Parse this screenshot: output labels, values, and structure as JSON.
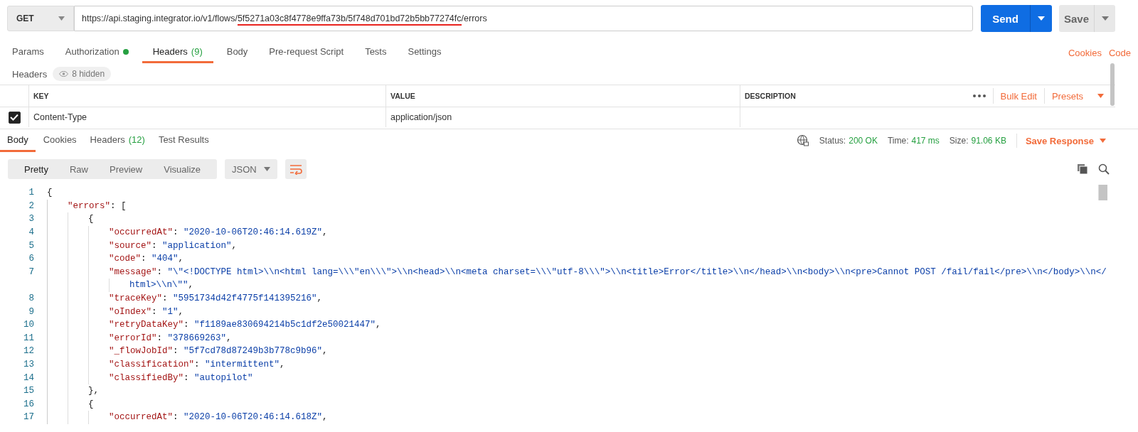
{
  "request": {
    "method": "GET",
    "url": {
      "prefix": "https://api.staging.integrator.io/v1/flows/",
      "underlined": "5f5271a03c8f4778e9ffa73b/5f748d701bd72b5bb77274fc",
      "suffix": "/errors"
    },
    "send_label": "Send",
    "save_label": "Save"
  },
  "request_tabs": [
    {
      "label": "Params",
      "selected": false,
      "dot": false
    },
    {
      "label": "Authorization",
      "selected": false,
      "dot": true
    },
    {
      "label": "Headers",
      "count": "(9)",
      "selected": true,
      "dot": false
    },
    {
      "label": "Body",
      "selected": false,
      "dot": false
    },
    {
      "label": "Pre-request Script",
      "selected": false,
      "dot": false
    },
    {
      "label": "Tests",
      "selected": false,
      "dot": false
    },
    {
      "label": "Settings",
      "selected": false,
      "dot": false
    }
  ],
  "request_links": [
    "Cookies",
    "Code"
  ],
  "headers_bar": {
    "title": "Headers",
    "hidden_label": "8 hidden"
  },
  "headers_table": {
    "columns": [
      "KEY",
      "VALUE",
      "DESCRIPTION"
    ],
    "actions": [
      "Bulk Edit",
      "Presets"
    ],
    "rows": [
      {
        "checked": true,
        "key": "Content-Type",
        "value": "application/json"
      }
    ]
  },
  "response_tabs": [
    {
      "label": "Body",
      "selected": true
    },
    {
      "label": "Cookies",
      "selected": false
    },
    {
      "label": "Headers",
      "count": "(12)",
      "selected": false
    },
    {
      "label": "Test Results",
      "selected": false
    }
  ],
  "response_status": [
    {
      "label": "Status:",
      "value": "200 OK"
    },
    {
      "label": "Time:",
      "value": "417 ms"
    },
    {
      "label": "Size:",
      "value": "91.06 KB"
    }
  ],
  "save_response": "Save Response",
  "view_modes": [
    {
      "label": "Pretty",
      "selected": true
    },
    {
      "label": "Raw",
      "selected": false
    },
    {
      "label": "Preview",
      "selected": false
    },
    {
      "label": "Visualize",
      "selected": false
    }
  ],
  "format": "JSON",
  "code_lines": [
    {
      "number": "1",
      "tokens": [
        {
          "kind": "open",
          "text": "{"
        }
      ]
    },
    {
      "number": "2",
      "tokens": [
        {
          "kind": "key",
          "text": "\"errors\""
        },
        {
          "kind": "punct",
          "text": ": "
        },
        {
          "kind": "open",
          "text": "["
        }
      ]
    },
    {
      "number": "3",
      "tokens": [
        {
          "kind": "open",
          "text": "{"
        }
      ]
    },
    {
      "number": "4",
      "tokens": [
        {
          "kind": "key",
          "text": "\"occurredAt\""
        },
        {
          "kind": "punct",
          "text": ": "
        },
        {
          "kind": "string",
          "text": "\"2020-10-06T20:46:14.619Z\""
        },
        {
          "kind": "punct",
          "text": ","
        }
      ]
    },
    {
      "number": "5",
      "tokens": [
        {
          "kind": "key",
          "text": "\"source\""
        },
        {
          "kind": "punct",
          "text": ": "
        },
        {
          "kind": "string",
          "text": "\"application\""
        },
        {
          "kind": "punct",
          "text": ","
        }
      ]
    },
    {
      "number": "6",
      "tokens": [
        {
          "kind": "key",
          "text": "\"code\""
        },
        {
          "kind": "punct",
          "text": ": "
        },
        {
          "kind": "string",
          "text": "\"404\""
        },
        {
          "kind": "punct",
          "text": ","
        }
      ]
    },
    {
      "number": "7",
      "tokens": [
        {
          "kind": "key",
          "text": "\"message\""
        },
        {
          "kind": "punct",
          "text": ": "
        },
        {
          "kind": "string",
          "text": "\"\\\"<!DOCTYPE html>\\\\n<html lang=\\\\\\\"en\\\\\\\">\\\\n<head>\\\\n<meta charset=\\\\\\\"utf-8\\\\\\\">\\\\n<title>Error</title>\\\\n</head>\\\\n<body>\\\\n<pre>Cannot POST /fail/fail</pre>\\\\n</body>\\\\n</"
        }
      ]
    },
    {
      "tokens": [
        {
          "kind": "string",
          "text": "html>\\\\n\\\"\""
        },
        {
          "kind": "punct",
          "text": ","
        }
      ]
    },
    {
      "number": "8",
      "tokens": [
        {
          "kind": "key",
          "text": "\"traceKey\""
        },
        {
          "kind": "punct",
          "text": ": "
        },
        {
          "kind": "string",
          "text": "\"5951734d42f4775f141395216\""
        },
        {
          "kind": "punct",
          "text": ","
        }
      ]
    },
    {
      "number": "9",
      "tokens": [
        {
          "kind": "key",
          "text": "\"oIndex\""
        },
        {
          "kind": "punct",
          "text": ": "
        },
        {
          "kind": "string",
          "text": "\"1\""
        },
        {
          "kind": "punct",
          "text": ","
        }
      ]
    },
    {
      "number": "10",
      "tokens": [
        {
          "kind": "key",
          "text": "\"retryDataKey\""
        },
        {
          "kind": "punct",
          "text": ": "
        },
        {
          "kind": "string",
          "text": "\"f1189ae830694214b5c1df2e50021447\""
        },
        {
          "kind": "punct",
          "text": ","
        }
      ]
    },
    {
      "number": "11",
      "tokens": [
        {
          "kind": "key",
          "text": "\"errorId\""
        },
        {
          "kind": "punct",
          "text": ": "
        },
        {
          "kind": "string",
          "text": "\"378669263\""
        },
        {
          "kind": "punct",
          "text": ","
        }
      ]
    },
    {
      "number": "12",
      "tokens": [
        {
          "kind": "key",
          "text": "\"_flowJobId\""
        },
        {
          "kind": "punct",
          "text": ": "
        },
        {
          "kind": "string",
          "text": "\"5f7cd78d87249b3b778c9b96\""
        },
        {
          "kind": "punct",
          "text": ","
        }
      ]
    },
    {
      "number": "13",
      "tokens": [
        {
          "kind": "key",
          "text": "\"classification\""
        },
        {
          "kind": "punct",
          "text": ": "
        },
        {
          "kind": "string",
          "text": "\"intermittent\""
        },
        {
          "kind": "punct",
          "text": ","
        }
      ]
    },
    {
      "number": "14",
      "tokens": [
        {
          "kind": "key",
          "text": "\"classifiedBy\""
        },
        {
          "kind": "punct",
          "text": ": "
        },
        {
          "kind": "string",
          "text": "\"autopilot\""
        }
      ]
    },
    {
      "number": "15",
      "tokens": [
        {
          "kind": "close",
          "text": "},"
        }
      ]
    },
    {
      "number": "16",
      "tokens": [
        {
          "kind": "open",
          "text": "{"
        }
      ]
    },
    {
      "number": "17",
      "tokens": [
        {
          "kind": "key",
          "text": "\"occurredAt\""
        },
        {
          "kind": "punct",
          "text": ": "
        },
        {
          "kind": "string",
          "text": "\"2020-10-06T20:46:14.618Z\""
        },
        {
          "kind": "punct",
          "text": ","
        }
      ]
    }
  ]
}
